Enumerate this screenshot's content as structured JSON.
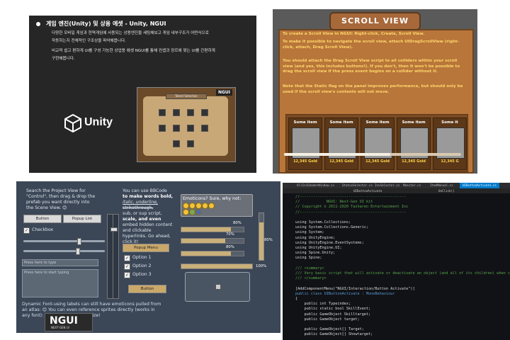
{
  "slide": {
    "heading": "게임 엔진(Unity) 및 상용 에셋 - Unity, NGUI",
    "paragraph_lines": [
      "다양한 모바일 게임과 현역게임에 사용되는 상용엔진을 세팅해보고 게임 내부구조가 어떤식으로",
      "작동하는지 전체적인 구조상을 파악해봅니다.",
      "비교적 쉽고 편하게 UI를 구성 가능한 상업용 에셋 NGUI를 통해 컨셉과 장르에 맞는 UI를 간편하게",
      "구현해봅니다."
    ],
    "unity_logo_text": "Unity",
    "thumb_badge": "NGUI",
    "thumb_title": "Talent Selection"
  },
  "scroll_view": {
    "title": "SCROLL VIEW",
    "paragraphs": [
      "To create a Scroll View in NGUI: Right-click, Create, Scroll View.",
      "To make it possible to navigate the scroll view, attach UIDragScrollView (right-click, attach, Drag Scroll View).",
      "You should attach the Drag Scroll View script to all colliders within your scroll view (and yes, this includes buttons!). If you don't, then it won't be possible to drag the scroll view if the press event begins on a collider without it.",
      "Note that the Static flag on the panel improves performance, but should only be used if the scroll view's contents will not move."
    ],
    "items": [
      {
        "name": "Some item",
        "price": "12,345 Gold"
      },
      {
        "name": "Some item",
        "price": "12,345 Gold"
      },
      {
        "name": "Some item",
        "price": "12,345 Gold"
      },
      {
        "name": "Some item",
        "price": "12,345 Gold"
      },
      {
        "name": "Some it",
        "price": "12,345 G"
      }
    ],
    "scroll_position": 0.6
  },
  "widgets": {
    "intro_lines": [
      "Search the Project View for",
      "\"Control\", then drag & drop the",
      "prefab you want directly into",
      "the Scene View. 😊"
    ],
    "button_label": "Button",
    "popup_list_label": "Popup List",
    "checkbox_label": "Checkbox",
    "input_placeholder": "Press here to type",
    "textarea_placeholder": "Press here to start typing",
    "bbcode_lines": [
      "You can use BBCode",
      "to make words bold,",
      "italic, underline,",
      "strikethrough,",
      "sub, or sup script,",
      "scale, and even",
      "embed hidden content",
      "and clickable",
      "hyperlinks. Go ahead,",
      "click it!"
    ],
    "popup_menu_label": "Popup Menu",
    "options": [
      "Option 1",
      "Option 2",
      "Option 3"
    ],
    "bottom_button": "Button",
    "emoticons_title": "Emoticons? Sure, why not:",
    "progress": [
      {
        "label": "80%",
        "value": 0.8
      },
      {
        "label": "70%",
        "value": 0.7
      },
      {
        "label": "80%",
        "value": 0.8
      },
      {
        "label": "100%",
        "value": 1.0
      }
    ],
    "vertical_label": "80%",
    "dynamic_font_lines": [
      "Dynamic Font-using labels can still have emoticons pulled from",
      "an atlas: 😊 You can even reference sprites directly (works in",
      "any font): — but do mind their size!"
    ],
    "logo_text": "NGUI",
    "logo_sub": "NEXT-GEN UI"
  },
  "editor": {
    "tabs": [
      "AllIn1ShaderWindow.cs",
      "StatusSelector.cs",
      "InvSelector.cs",
      "Monster.cs",
      "ItemManual.cs",
      "UIButtonActivate.cs"
    ],
    "nav": [
      "UIButtonActivate",
      "OnClick()"
    ],
    "lines": [
      {
        "t": "//------------------------------------------------",
        "c": "c-com"
      },
      {
        "t": "//            NGUI: Next-Gen UI kit",
        "c": "c-com"
      },
      {
        "t": "// Copyright © 2011-2020 Tasharen Entertainment Inc",
        "c": "c-com"
      },
      {
        "t": "//------------------------------------------------",
        "c": "c-com"
      },
      {
        "t": "",
        "c": "c-tx"
      },
      {
        "t": "using System.Collections;",
        "c": "c-tx"
      },
      {
        "t": "using System.Collections.Generic;",
        "c": "c-tx"
      },
      {
        "t": "using System;",
        "c": "c-tx"
      },
      {
        "t": "using UnityEngine;",
        "c": "c-tx"
      },
      {
        "t": "using UnityEngine.EventSystems;",
        "c": "c-tx"
      },
      {
        "t": "using UnityEngine.UI;",
        "c": "c-tx"
      },
      {
        "t": "using Spine.Unity;",
        "c": "c-tx"
      },
      {
        "t": "using Spine;",
        "c": "c-tx"
      },
      {
        "t": "",
        "c": "c-tx"
      },
      {
        "t": "/// <summary>",
        "c": "c-com"
      },
      {
        "t": "/// Very basic script that will activate or deactivate an object (and all of its children) when clicked.",
        "c": "c-com"
      },
      {
        "t": "/// </summary>",
        "c": "c-com"
      },
      {
        "t": "",
        "c": "c-tx"
      },
      {
        "t": "[AddComponentMenu(\"NGUI/Interaction/Button Activate\")]",
        "c": "c-tx"
      },
      {
        "t": "public class UIButtonActivate : MonoBehaviour",
        "c": "c-kw"
      },
      {
        "t": "{",
        "c": "c-tx"
      },
      {
        "t": "    public int Typeindex;",
        "c": "c-tx"
      },
      {
        "t": "    public static bool SkillEvent;",
        "c": "c-tx"
      },
      {
        "t": "    public GameObject Skilltarget;",
        "c": "c-tx"
      },
      {
        "t": "    public GameObject target;",
        "c": "c-tx"
      },
      {
        "t": "",
        "c": "c-tx"
      },
      {
        "t": "    public GameObject[] Target;",
        "c": "c-tx"
      },
      {
        "t": "    public GameObject[] Showtarget;",
        "c": "c-tx"
      }
    ]
  },
  "colors": {
    "slide_bg": "#262626",
    "scroll_text": "#ffd56a",
    "widget_bg": "#3b4656",
    "link_blue": "#38a4ff",
    "editor_bg": "#111216",
    "editor_tab_active": "#007acc"
  }
}
